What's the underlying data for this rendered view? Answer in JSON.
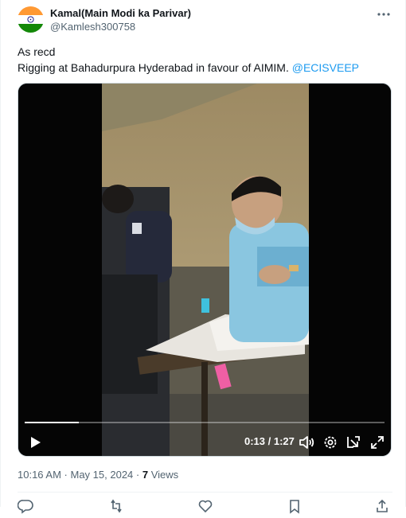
{
  "author": {
    "display_name": "Kamal(Main Modi ka Parivar)",
    "handle": "@Kamlesh300758",
    "avatar_icon": "india-flag-avatar"
  },
  "more_icon": "ellipsis-icon",
  "tweet": {
    "line1": "As recd",
    "line2_text": "Rigging at Bahadurpura Hyderabad in favour of AIMIM. ",
    "mention": "@ECISVEEP"
  },
  "video": {
    "current_time": "0:13",
    "separator": " / ",
    "duration": "1:27",
    "progress": 0.15,
    "controls": [
      "play-icon",
      "volume-icon",
      "settings-icon",
      "picture-in-picture-icon",
      "fullscreen-icon"
    ]
  },
  "meta": {
    "time": "10:16 AM",
    "dot": " · ",
    "date": "May 15, 2024",
    "views_count": "7",
    "views_label": " Views"
  },
  "colors": {
    "accent": "#1d9bf0",
    "secondary_text": "#536471"
  }
}
